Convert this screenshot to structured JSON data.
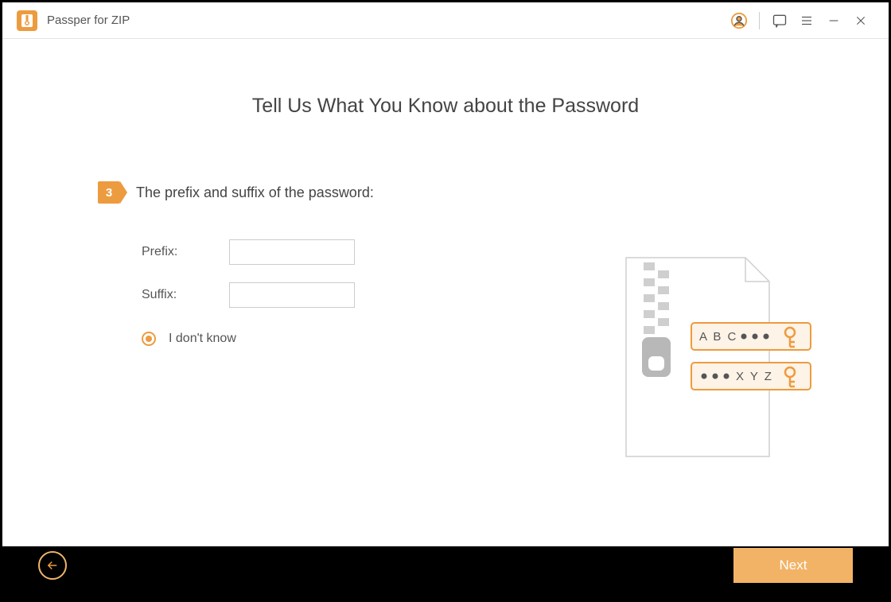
{
  "app": {
    "title": "Passper for ZIP"
  },
  "page": {
    "heading": "Tell Us What You Know about the Password"
  },
  "step": {
    "number": "3",
    "text": "The prefix and suffix of the password:"
  },
  "form": {
    "prefix_label": "Prefix:",
    "suffix_label": "Suffix:",
    "prefix_value": "",
    "suffix_value": "",
    "dontknow_label": "I don't know",
    "dontknow_selected": true
  },
  "illustration": {
    "hint1_text": "A B C",
    "hint2_text": "X Y Z"
  },
  "nav": {
    "next_label": "Next"
  },
  "colors": {
    "accent": "#ed9b3f",
    "accent_light": "#f2b366"
  }
}
